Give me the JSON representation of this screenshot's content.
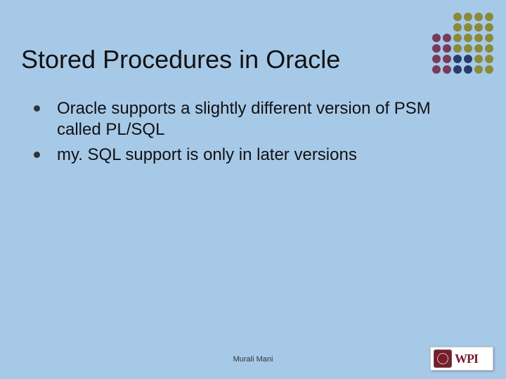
{
  "title": "Stored Procedures in Oracle",
  "bullets": [
    "Oracle supports a slightly different version of PSM called PL/SQL",
    "my. SQL support is only in later versions"
  ],
  "footer": {
    "author": "Murali Mani",
    "logo_text": "WPI"
  },
  "decor": {
    "dot_colors": {
      "olive": "#8a8a3a",
      "maroon": "#7a3a5a",
      "navy": "#2a3a6a",
      "bg": "#a7c9e8"
    },
    "grid": [
      [
        "bg",
        "bg",
        "olive",
        "olive",
        "olive",
        "olive"
      ],
      [
        "bg",
        "bg",
        "olive",
        "olive",
        "olive",
        "olive"
      ],
      [
        "maroon",
        "maroon",
        "olive",
        "olive",
        "olive",
        "olive"
      ],
      [
        "maroon",
        "maroon",
        "olive",
        "olive",
        "olive",
        "olive"
      ],
      [
        "maroon",
        "maroon",
        "navy",
        "navy",
        "olive",
        "olive"
      ],
      [
        "maroon",
        "maroon",
        "navy",
        "navy",
        "olive",
        "olive"
      ]
    ]
  }
}
